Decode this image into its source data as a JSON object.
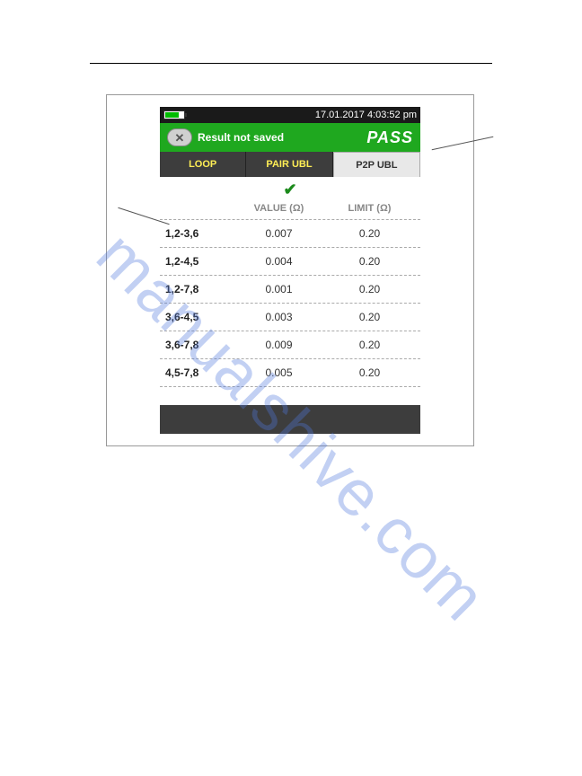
{
  "status": {
    "datetime": "17.01.2017 4:03:52 pm"
  },
  "header": {
    "saved_text": "Result not saved",
    "result": "PASS"
  },
  "tabs": {
    "loop": "LOOP",
    "pair": "PAIR UBL",
    "p2p": "P2P UBL"
  },
  "table": {
    "col_value": "VALUE (Ω)",
    "col_limit": "LIMIT (Ω)",
    "rows": [
      {
        "pair": "1,2-3,6",
        "value": "0.007",
        "limit": "0.20"
      },
      {
        "pair": "1,2-4,5",
        "value": "0.004",
        "limit": "0.20"
      },
      {
        "pair": "1,2-7,8",
        "value": "0.001",
        "limit": "0.20"
      },
      {
        "pair": "3,6-4,5",
        "value": "0.003",
        "limit": "0.20"
      },
      {
        "pair": "3,6-7,8",
        "value": "0.009",
        "limit": "0.20"
      },
      {
        "pair": "4,5-7,8",
        "value": "0.005",
        "limit": "0.20"
      }
    ]
  },
  "watermark": "manualshive.com"
}
